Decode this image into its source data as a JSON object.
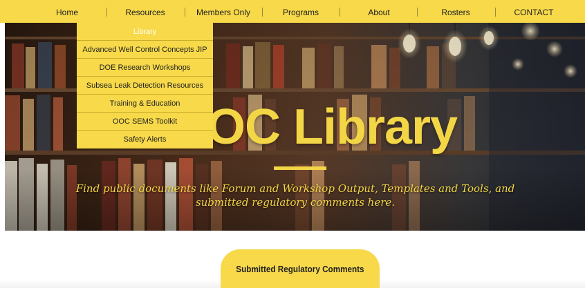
{
  "nav": {
    "items": [
      {
        "label": "Home"
      },
      {
        "label": "Resources"
      },
      {
        "label": "Members Only"
      },
      {
        "label": "Programs"
      },
      {
        "label": "About"
      },
      {
        "label": "Rosters"
      },
      {
        "label": "CONTACT"
      }
    ]
  },
  "dropdown": {
    "items": [
      {
        "label": "Library",
        "active": true
      },
      {
        "label": "Advanced Well Control Concepts JIP"
      },
      {
        "label": "DOE Research Workshops"
      },
      {
        "label": "Subsea Leak Detection Resources"
      },
      {
        "label": "Training & Education"
      },
      {
        "label": "OOC SEMS Toolkit"
      },
      {
        "label": "Safety Alerts"
      }
    ]
  },
  "hero": {
    "title": "OOC Library",
    "subtitle": "Find public documents like Forum and Workshop Output, Templates and Tools, and submitted regulatory comments here."
  },
  "cta": {
    "label": "Submitted Regulatory Comments"
  },
  "colors": {
    "accent": "#f7d94a",
    "hero_text": "#f3d646",
    "dropdown_active_text": "#ffffff"
  }
}
